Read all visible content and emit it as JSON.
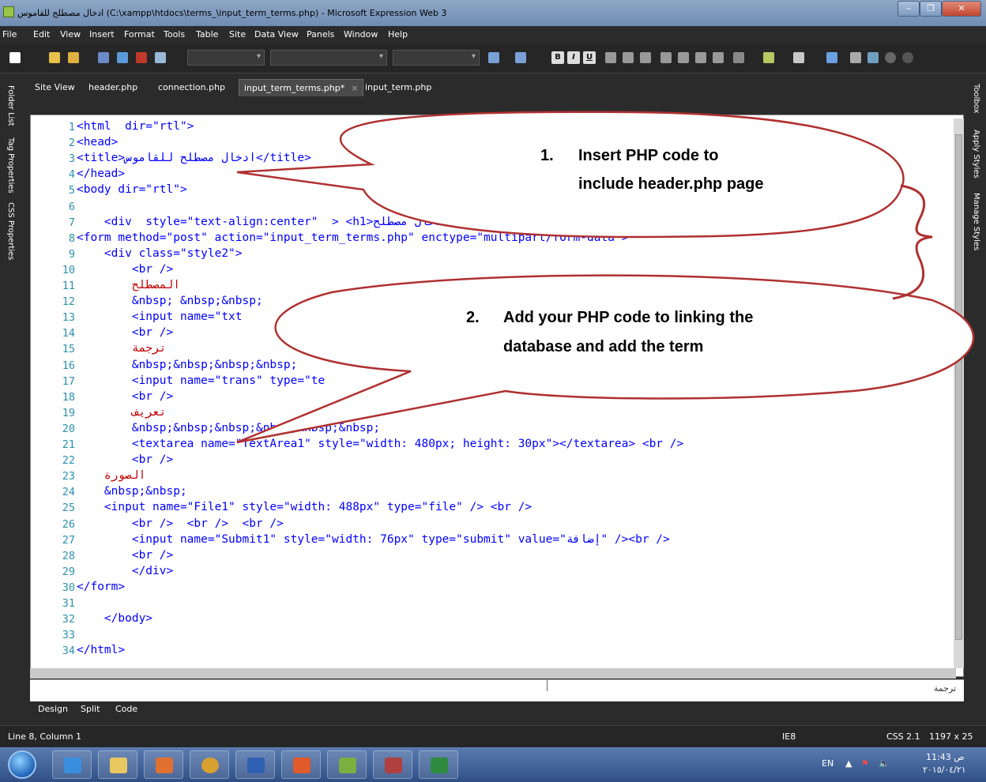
{
  "window": {
    "title": "ادخال مصطلح للقاموس (C:\\xampp\\htdocs\\terms_\\input_term_terms.php) - Microsoft Expression Web 3",
    "min_label": "‒",
    "max_label": "❐",
    "close_label": "✕"
  },
  "menu": [
    "File",
    "Edit",
    "View",
    "Insert",
    "Format",
    "Tools",
    "Table",
    "Site",
    "Data View",
    "Panels",
    "Window",
    "Help"
  ],
  "format_buttons": [
    "B",
    "I",
    "U"
  ],
  "left_panels": [
    "Folder List",
    "Tag Properties",
    "CSS Properties"
  ],
  "right_panels": [
    "Toolbox",
    "Apply Styles",
    "Manage Styles"
  ],
  "tabs": [
    {
      "label": "Site View"
    },
    {
      "label": "header.php"
    },
    {
      "label": "connection.php"
    },
    {
      "label": "input_term_terms.php*",
      "close": "×"
    },
    {
      "label": "input_term.php"
    }
  ],
  "code_lines": [
    [
      "1",
      "<html  dir=\"rtl\">"
    ],
    [
      "2",
      "<head>"
    ],
    [
      "3",
      "<title>ادخال مصطلح للقاموس</title>"
    ],
    [
      "4",
      "</head>"
    ],
    [
      "5",
      "<body dir=\"rtl\">"
    ],
    [
      "6",
      ""
    ],
    [
      "7",
      "    <div  style=\"text-align:center\"  > <h1>ادخال مصطلح"
    ],
    [
      "8",
      "<form method=\"post\" action=\"input_term_terms.php\" enctype=\"multipart/form-data\">"
    ],
    [
      "9",
      "    <div class=\"style2\">"
    ],
    [
      "10",
      "        <br />"
    ],
    [
      "11",
      "        المصطلح"
    ],
    [
      "12",
      "        &nbsp; &nbsp;&nbsp;"
    ],
    [
      "13",
      "        <input name=\"txt"
    ],
    [
      "14",
      "        <br />"
    ],
    [
      "15",
      "        ترجمة"
    ],
    [
      "16",
      "        &nbsp;&nbsp;&nbsp;&nbsp;"
    ],
    [
      "17",
      "        <input name=\"trans\" type=\"te"
    ],
    [
      "18",
      "        <br />"
    ],
    [
      "19",
      "        تعريف"
    ],
    [
      "20",
      "        &nbsp;&nbsp;&nbsp;&nbsp;&nbsp;&nbsp;"
    ],
    [
      "21",
      "        <textarea name=\"TextArea1\" style=\"width: 480px; height: 30px\"></textarea> <br />"
    ],
    [
      "22",
      "        <br />"
    ],
    [
      "23",
      "    الصورة"
    ],
    [
      "24",
      "    &nbsp;&nbsp;"
    ],
    [
      "25",
      "    <input name=\"File1\" style=\"width: 488px\" type=\"file\" /> <br />"
    ],
    [
      "26",
      "        <br />  <br />  <br />"
    ],
    [
      "27",
      "        <input name=\"Submit1\" style=\"width: 76px\" type=\"submit\" value=\"إضافة\" /><br />"
    ],
    [
      "28",
      "        <br />"
    ],
    [
      "29",
      "        </div>"
    ],
    [
      "30",
      "</form>"
    ],
    [
      "31",
      ""
    ],
    [
      "32",
      "    </body>"
    ],
    [
      "33",
      ""
    ],
    [
      "34",
      "</html>"
    ]
  ],
  "callouts": {
    "c1_num": "1.",
    "c1_line1": "Insert PHP code to",
    "c1_line2": "include header.php page",
    "c2_num": "2.",
    "c2_line1": "Add your PHP code to linking the",
    "c2_line2": "database and add the term"
  },
  "design_preview_text": "ترجمة",
  "view_tabs": [
    "Design",
    "Split",
    "Code"
  ],
  "status": {
    "position": "Line 8, Column 1",
    "browser": "IE8",
    "css": "CSS 2.1",
    "size": "1197 x 25"
  },
  "tray": {
    "lang": "EN",
    "time": "11:43 ص",
    "date": "٢٠١٥/٠٤/٢١"
  }
}
